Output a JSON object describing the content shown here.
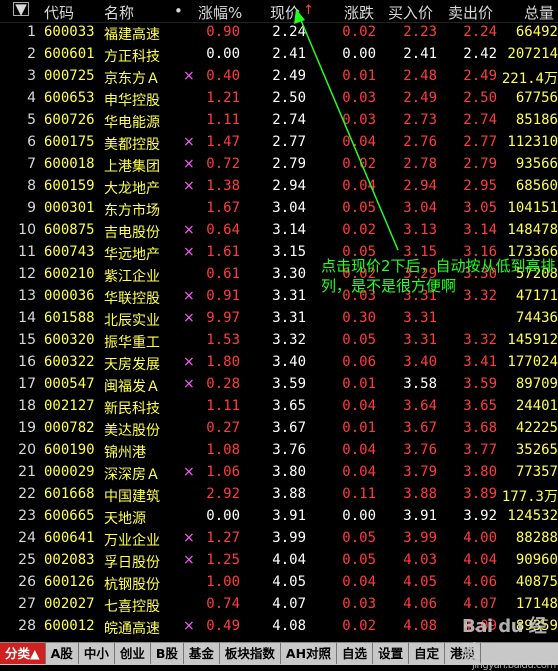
{
  "header": {
    "sort_icon": "▼",
    "code": "代码",
    "name": "名称",
    "dot": "•",
    "change_pct": "涨幅%",
    "price": "现价",
    "price_sort_arrow": "↑",
    "change": "涨跌",
    "bid": "买入价",
    "ask": "卖出价",
    "volume": "总量"
  },
  "rows": [
    {
      "idx": "1",
      "code": "600033",
      "name": "福建高速",
      "mark": "",
      "chg": "0.90",
      "price": "2.24",
      "diff": "0.02",
      "buy": "2.23",
      "sell": "2.24",
      "vol": "66492",
      "up": true
    },
    {
      "idx": "2",
      "code": "600601",
      "name": "方正科技",
      "mark": "",
      "chg": "0.00",
      "price": "2.41",
      "diff": "0.00",
      "buy": "2.41",
      "sell": "2.42",
      "vol": "207214",
      "up": false
    },
    {
      "idx": "3",
      "code": "000725",
      "name": "京东方Ａ",
      "mark": "×",
      "chg": "0.40",
      "price": "2.49",
      "diff": "0.01",
      "buy": "2.48",
      "sell": "2.49",
      "vol": "221.4万",
      "up": true
    },
    {
      "idx": "4",
      "code": "600653",
      "name": "申华控股",
      "mark": "",
      "chg": "1.21",
      "price": "2.50",
      "diff": "0.03",
      "buy": "2.49",
      "sell": "2.50",
      "vol": "67756",
      "up": true
    },
    {
      "idx": "5",
      "code": "600726",
      "name": "华电能源",
      "mark": "",
      "chg": "1.11",
      "price": "2.74",
      "diff": "0.03",
      "buy": "2.73",
      "sell": "2.74",
      "vol": "85186",
      "up": true
    },
    {
      "idx": "6",
      "code": "600175",
      "name": "美都控股",
      "mark": "×",
      "chg": "1.47",
      "price": "2.77",
      "diff": "0.04",
      "buy": "2.76",
      "sell": "2.77",
      "vol": "112310",
      "up": true
    },
    {
      "idx": "7",
      "code": "600018",
      "name": "上港集团",
      "mark": "×",
      "chg": "0.72",
      "price": "2.79",
      "diff": "0.02",
      "buy": "2.78",
      "sell": "2.79",
      "vol": "93566",
      "up": true
    },
    {
      "idx": "8",
      "code": "600159",
      "name": "大龙地产",
      "mark": "×",
      "chg": "1.38",
      "price": "2.94",
      "diff": "0.04",
      "buy": "2.94",
      "sell": "2.95",
      "vol": "68560",
      "up": true
    },
    {
      "idx": "9",
      "code": "000301",
      "name": "东方市场",
      "mark": "",
      "chg": "1.67",
      "price": "3.04",
      "diff": "0.05",
      "buy": "3.04",
      "sell": "3.05",
      "vol": "104151",
      "up": true
    },
    {
      "idx": "10",
      "code": "600875",
      "name": "吉电股份",
      "mark": "×",
      "chg": "0.64",
      "price": "3.14",
      "diff": "0.02",
      "buy": "3.13",
      "sell": "3.14",
      "vol": "148478",
      "up": true
    },
    {
      "idx": "11",
      "code": "600743",
      "name": "华远地产",
      "mark": "×",
      "chg": "1.61",
      "price": "3.15",
      "diff": "0.05",
      "buy": "3.15",
      "sell": "3.16",
      "vol": "173366",
      "up": true
    },
    {
      "idx": "12",
      "code": "600210",
      "name": "紫江企业",
      "mark": "",
      "chg": "0.61",
      "price": "3.30",
      "diff": "0.02",
      "buy": "3.29",
      "sell": "3.30",
      "vol": "57208",
      "up": true
    },
    {
      "idx": "13",
      "code": "000036",
      "name": "华联控股",
      "mark": "×",
      "chg": "0.91",
      "price": "3.31",
      "diff": "0.03",
      "buy": "3.31",
      "sell": "3.32",
      "vol": "47171",
      "up": true
    },
    {
      "idx": "14",
      "code": "601588",
      "name": "北辰实业",
      "mark": "×",
      "chg": "9.97",
      "price": "3.31",
      "diff": "0.30",
      "buy": "3.31",
      "sell": "",
      "vol": "74436",
      "up": true
    },
    {
      "idx": "15",
      "code": "600320",
      "name": "振华重工",
      "mark": "",
      "chg": "1.53",
      "price": "3.32",
      "diff": "0.05",
      "buy": "3.31",
      "sell": "3.32",
      "vol": "145912",
      "up": true
    },
    {
      "idx": "16",
      "code": "600322",
      "name": "天房发展",
      "mark": "×",
      "chg": "1.80",
      "price": "3.40",
      "diff": "0.06",
      "buy": "3.40",
      "sell": "3.41",
      "vol": "177024",
      "up": true
    },
    {
      "idx": "17",
      "code": "000547",
      "name": "闽福发Ａ",
      "mark": "×",
      "chg": "0.28",
      "price": "3.59",
      "diff": "0.01",
      "buy": "3.58",
      "sell": "3.59",
      "vol": "89709",
      "up": true
    },
    {
      "idx": "18",
      "code": "002127",
      "name": "新民科技",
      "mark": "",
      "chg": "1.11",
      "price": "3.65",
      "diff": "0.04",
      "buy": "3.64",
      "sell": "3.65",
      "vol": "24401",
      "up": true
    },
    {
      "idx": "19",
      "code": "000782",
      "name": "美达股份",
      "mark": "",
      "chg": "0.27",
      "price": "3.67",
      "diff": "0.01",
      "buy": "3.67",
      "sell": "3.68",
      "vol": "42225",
      "up": true
    },
    {
      "idx": "20",
      "code": "600190",
      "name": "锦州港",
      "mark": "",
      "chg": "1.08",
      "price": "3.76",
      "diff": "0.04",
      "buy": "3.76",
      "sell": "3.77",
      "vol": "35265",
      "up": true
    },
    {
      "idx": "21",
      "code": "000029",
      "name": "深深房Ａ",
      "mark": "×",
      "chg": "1.06",
      "price": "3.80",
      "diff": "0.04",
      "buy": "3.79",
      "sell": "3.80",
      "vol": "77357",
      "up": true
    },
    {
      "idx": "22",
      "code": "601668",
      "name": "中国建筑",
      "mark": "",
      "chg": "2.92",
      "price": "3.88",
      "diff": "0.11",
      "buy": "3.88",
      "sell": "3.89",
      "vol": "177.3万",
      "up": true
    },
    {
      "idx": "23",
      "code": "600665",
      "name": "天地源",
      "mark": "",
      "chg": "0.00",
      "price": "3.91",
      "diff": "0.00",
      "buy": "3.91",
      "sell": "3.92",
      "vol": "124532",
      "up": false
    },
    {
      "idx": "24",
      "code": "600641",
      "name": "万业企业",
      "mark": "×",
      "chg": "1.27",
      "price": "3.99",
      "diff": "0.05",
      "buy": "3.99",
      "sell": "4.00",
      "vol": "88288",
      "up": true
    },
    {
      "idx": "25",
      "code": "002083",
      "name": "孚日股份",
      "mark": "×",
      "chg": "1.25",
      "price": "4.04",
      "diff": "0.05",
      "buy": "4.03",
      "sell": "4.04",
      "vol": "90960",
      "up": true
    },
    {
      "idx": "26",
      "code": "600126",
      "name": "杭钢股份",
      "mark": "",
      "chg": "1.00",
      "price": "4.05",
      "diff": "0.04",
      "buy": "4.05",
      "sell": "4.06",
      "vol": "40875",
      "up": true
    },
    {
      "idx": "27",
      "code": "002027",
      "name": "七喜控股",
      "mark": "",
      "chg": "0.74",
      "price": "4.07",
      "diff": "0.03",
      "buy": "4.06",
      "sell": "4.07",
      "vol": "17148",
      "up": true
    },
    {
      "idx": "28",
      "code": "600012",
      "name": "皖通高速",
      "mark": "×",
      "chg": "0.49",
      "price": "4.08",
      "diff": "0.02",
      "buy": "4.08",
      "sell": "4.09",
      "vol": "89359",
      "up": true
    }
  ],
  "annotation": "点击现价2下后，自动按从低到高排列，是不是很方便啊",
  "tabs": [
    "分类▲",
    "A股",
    "中小",
    "创业",
    "B股",
    "基金",
    "板块指数",
    "AH对照",
    "自选",
    "设置",
    "自定",
    "港股"
  ],
  "watermark": "Bai du 经验",
  "watermark_sub": "jingyan.baidu.com",
  "colors": {
    "up": "#ff3c3c",
    "flat": "#ffffff",
    "stock_name": "#ffff50",
    "annotation": "#22ff22",
    "active_tab": "#d02020"
  }
}
